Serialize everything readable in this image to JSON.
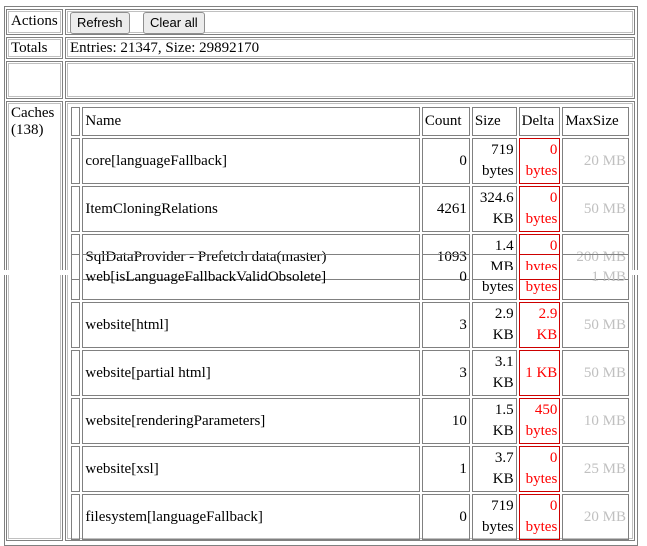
{
  "labels": {
    "actions": "Actions",
    "totals": "Totals",
    "caches": "Caches",
    "caches_count": "(138)"
  },
  "buttons": {
    "refresh": "Refresh",
    "clear_all": "Clear all"
  },
  "totals_text": "Entries: 21347, Size: 29892170",
  "columns": {
    "name": "Name",
    "count": "Count",
    "size": "Size",
    "delta": "Delta",
    "maxsize": "MaxSize"
  },
  "rows_top": [
    {
      "name": "core[languageFallback]",
      "count": "0",
      "size1": "719",
      "size2": "bytes",
      "delta1": "0",
      "delta2": "bytes",
      "max": "20 MB"
    },
    {
      "name": "ItemCloningRelations",
      "count": "4261",
      "size1": "324.6",
      "size2": "KB",
      "delta1": "0",
      "delta2": "bytes",
      "max": "50 MB"
    },
    {
      "name": "SqlDataProvider - Prefetch data(master)",
      "count": "1093",
      "size1": "1.4",
      "size2": "MB",
      "delta1": "0",
      "delta2": "bytes",
      "max": "200 MB"
    }
  ],
  "rows_bottom": [
    {
      "name": "web[isLanguageFallbackValidObsolete]",
      "count": "0",
      "size1": "",
      "size2": "bytes",
      "delta1": "",
      "delta2": "bytes",
      "max": "1 MB"
    },
    {
      "name": "website[html]",
      "count": "3",
      "size1": "2.9",
      "size2": "KB",
      "delta1": "2.9",
      "delta2": "KB",
      "max": "50 MB"
    },
    {
      "name": "website[partial html]",
      "count": "3",
      "size1": "3.1",
      "size2": "KB",
      "delta1": "1 KB",
      "delta2": "",
      "max": "50 MB"
    },
    {
      "name": "website[renderingParameters]",
      "count": "10",
      "size1": "1.5",
      "size2": "KB",
      "delta1": "450",
      "delta2": "bytes",
      "max": "10 MB"
    },
    {
      "name": "website[xsl]",
      "count": "1",
      "size1": "3.7",
      "size2": "KB",
      "delta1": "0",
      "delta2": "bytes",
      "max": "25 MB"
    },
    {
      "name": "filesystem[languageFallback]",
      "count": "0",
      "size1": "719",
      "size2": "bytes",
      "delta1": "0",
      "delta2": "bytes",
      "max": "20 MB"
    }
  ]
}
